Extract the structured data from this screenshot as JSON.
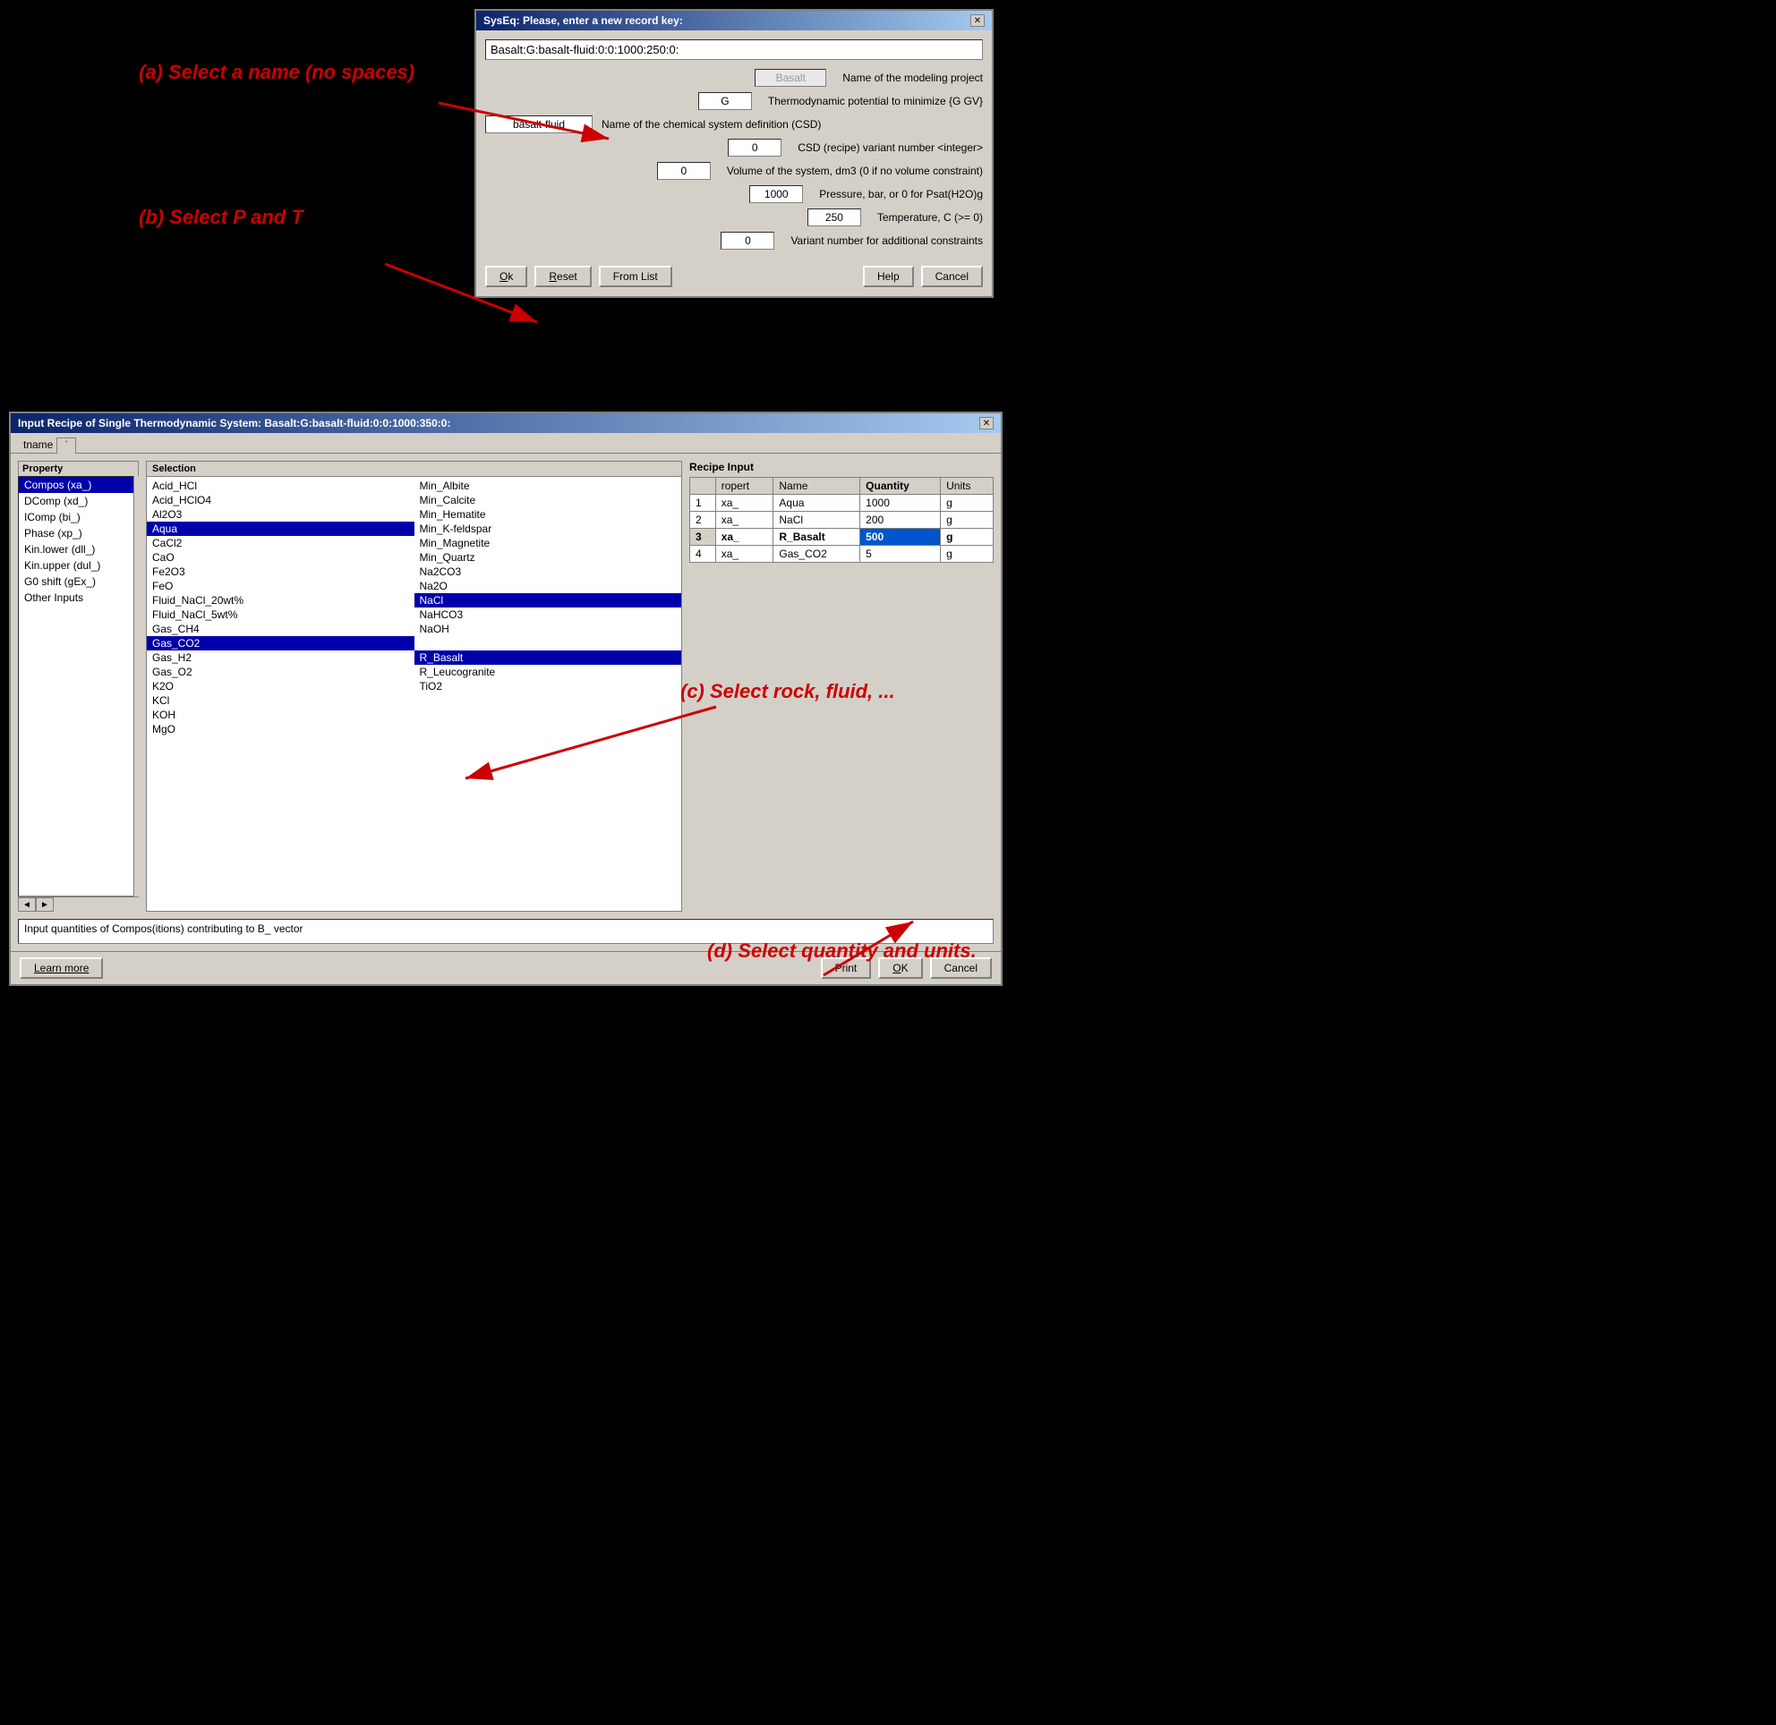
{
  "syseq_dialog": {
    "title": "SysEq: Please, enter a new record key:",
    "record_key": "Basalt:G:basalt-fluid:0:0:1000:250:0:",
    "fields": [
      {
        "input": "Basalt",
        "placeholder": true,
        "label": "Name of the modeling project",
        "size": "medium"
      },
      {
        "input": "G",
        "placeholder": false,
        "label": "Thermodynamic potential to minimize {G GV}",
        "size": "small"
      },
      {
        "input": "basalt-fluid",
        "placeholder": false,
        "label": "Name of the chemical system definition (CSD)",
        "size": "wide"
      },
      {
        "input": "0",
        "placeholder": false,
        "label": "CSD (recipe) variant number <integer>",
        "size": "small"
      },
      {
        "input": "0",
        "placeholder": false,
        "label": "Volume of the system, dm3 (0 if no volume constraint)",
        "size": "small"
      },
      {
        "input": "1000",
        "placeholder": false,
        "label": "Pressure, bar, or 0 for Psat(H2O)g",
        "size": "small"
      },
      {
        "input": "250",
        "placeholder": false,
        "label": "Temperature, C (>= 0)",
        "size": "small"
      },
      {
        "input": "0",
        "placeholder": false,
        "label": "Variant number for additional constraints",
        "size": "small"
      }
    ],
    "buttons": [
      "Ok",
      "Reset",
      "From List",
      "Help",
      "Cancel"
    ]
  },
  "recipe_dialog": {
    "title": "Input Recipe of Single Thermodynamic System: Basalt:G:basalt-fluid:0:0:1000:350:0:",
    "tab": "tname",
    "tab_char": "`",
    "properties": [
      {
        "label": "Compos (xa_)",
        "selected": true
      },
      {
        "label": "DComp (xd_)",
        "selected": false
      },
      {
        "label": "IComp (bi_)",
        "selected": false
      },
      {
        "label": "Phase (xp_)",
        "selected": false
      },
      {
        "label": "Kin.lower (dll_)",
        "selected": false
      },
      {
        "label": "Kin.upper (dul_)",
        "selected": false
      },
      {
        "label": "G0 shift (gEx_)",
        "selected": false
      },
      {
        "label": "Other Inputs",
        "selected": false
      }
    ],
    "selection_header": "Selection",
    "selection_col1": [
      "Acid_HCl",
      "Acid_HClO4",
      "Al2O3",
      "Aqua",
      "CaCl2",
      "CaO",
      "Fe2O3",
      "FeO",
      "Fluid_NaCl_20wt%",
      "Fluid_NaCl_5wt%",
      "Gas_CH4",
      "Gas_CO2",
      "Gas_H2",
      "Gas_O2",
      "K2O",
      "KCl",
      "KOH",
      "MgO"
    ],
    "selection_col1_selected": [
      "Aqua",
      "Gas_CO2"
    ],
    "selection_col2": [
      "Min_Albite",
      "Min_Calcite",
      "Min_Hematite",
      "Min_K-feldspar",
      "Min_Magnetite",
      "Min_Quartz",
      "Na2CO3",
      "Na2O",
      "NaCl",
      "NaHCO3",
      "NaOH",
      "",
      "R_Basalt",
      "R_Leucogranite",
      "TiO2"
    ],
    "selection_col2_selected": [
      "NaCl",
      "R_Basalt"
    ],
    "recipe_input_header": "Recipe Input",
    "recipe_columns": [
      "ropert",
      "Name",
      "Quantity",
      "Units"
    ],
    "recipe_rows": [
      {
        "row_num": "1",
        "ropert": "xa_",
        "name": "Aqua",
        "quantity": "1000",
        "units": "g",
        "highlighted": false
      },
      {
        "row_num": "2",
        "ropert": "xa_",
        "name": "NaCl",
        "quantity": "200",
        "units": "g",
        "highlighted": false
      },
      {
        "row_num": "3",
        "ropert": "xa_",
        "name": "R_Basalt",
        "quantity": "500",
        "units": "g",
        "highlighted": true
      },
      {
        "row_num": "4",
        "ropert": "xa_",
        "name": "Gas_CO2",
        "quantity": "5",
        "units": "g",
        "highlighted": false
      }
    ],
    "status_text": "Input quantities of Compos(itions) contributing to B_ vector",
    "buttons": {
      "learn_more": "Learn more",
      "print": "Print",
      "ok": "OK",
      "cancel": "Cancel"
    }
  },
  "annotations": {
    "a": "(a) Select a name (no spaces)",
    "b": "(b) Select  P and T",
    "c": "(c) Select  rock, fluid, ...",
    "d": "(d) Select  quantity and units."
  },
  "icons": {
    "close": "✕",
    "arrow_left": "◄",
    "arrow_right": "►"
  }
}
